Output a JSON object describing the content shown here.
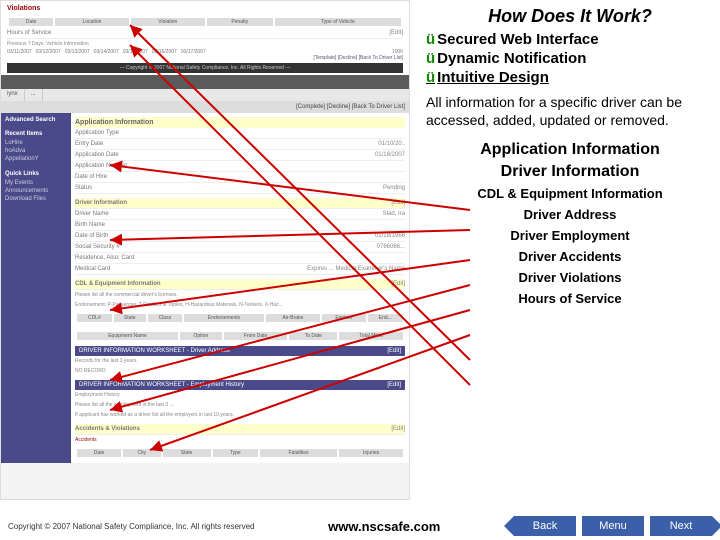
{
  "slide": {
    "heading": "How Does It Work?",
    "bullets": [
      "Secured Web Interface",
      "Dynamic Notification",
      "Intuitive Design"
    ],
    "paragraph": "All information for a specific driver can be accessed, added, updated or removed.",
    "info_titles": [
      "Application Information",
      "Driver Information"
    ],
    "info_items": [
      "CDL & Equipment Information",
      "Driver Address",
      "Driver Employment",
      "Driver Accidents",
      "Driver Violations",
      "Hours of Service"
    ],
    "url": "www.nscsafe.com",
    "copyright": "Copyright © 2007 National Safety Compliance, Inc. All rights reserved",
    "nav": {
      "back": "Back",
      "menu": "Menu",
      "next": "Next"
    }
  },
  "screenshot": {
    "top_section": {
      "violations_label": "Violations",
      "violations_cols": [
        "Date",
        "Location",
        "Violation",
        "Penalty",
        "Type of Vehicle"
      ],
      "hours_label": "Hours of Service",
      "hours_note": "Previous 7 Days, Vehicle Information",
      "dates": [
        "03/11/2007",
        "03/12/2007",
        "03/13/2007",
        "03/14/2007",
        "03/15/2007",
        "03/16/2007",
        "03/17/2007"
      ],
      "hours_total": "100h",
      "footer_links": "[Template]  [Decline]  [Back To Driver List]",
      "copyright_bar": "— Copyright © 2007 National Safety Compliance, Inc. All Rights Reserved —"
    },
    "toolbar_right": "[Complete]  [Decline]  [Back To Driver List]",
    "sidebar": {
      "adv_search": "Advanced Search",
      "recent_title": "Recent Items",
      "recent": [
        "LoHire",
        "hoAdva",
        "AppellationY"
      ],
      "quick_title": "Quick Links",
      "quick": [
        "My Events",
        "Announcements",
        "Download Files"
      ]
    },
    "app_info": {
      "title": "Application Information",
      "rows": [
        {
          "l": "Application Type",
          "r": ""
        },
        {
          "l": "Entry Date",
          "r": "01/10/20.."
        },
        {
          "l": "Application Date",
          "r": "01/18/2007"
        },
        {
          "l": "Application Number",
          "r": ""
        },
        {
          "l": "Date of Hire",
          "r": ""
        },
        {
          "l": "Status",
          "r": "Pending"
        }
      ]
    },
    "driver_info": {
      "title": "Driver Information",
      "edit": "[Edit]",
      "rows": [
        {
          "l": "Driver Name",
          "r": "Slad, Ira"
        },
        {
          "l": "Birth Name",
          "r": ""
        },
        {
          "l": "Date of Birth",
          "r": "01/18/1966"
        },
        {
          "l": "Social Security #",
          "r": "0786066..."
        },
        {
          "l": "Residence, Also: Card",
          "r": ""
        },
        {
          "l": "Medical Card",
          "r": "Expires ... Medical Examiner's Name"
        }
      ]
    },
    "cdl": {
      "title": "CDL & Equipment Information",
      "edit": "[Edit]",
      "note1": "Please list all the commercial driver's licenses.",
      "note2": "Endorsement: P-Passenger, T-Doubles & Triples, H-Hazardous Materials, N-Tankers, X-Haz...",
      "cols1": [
        "CDL#",
        "State",
        "Class",
        "Endorsements",
        "Air-Brake",
        "Expires",
        "End..."
      ],
      "cols2": [
        "Equipment Name",
        "Option",
        "From Date",
        "To Date",
        "Total Miles"
      ]
    },
    "worksheets": {
      "addr_title": "DRIVER INFORMATION WORKSHEET - Driver Address",
      "addr_note": "Records for the last 3 years.",
      "addr_rec": "NO RECORD",
      "emp_title": "DRIVER INFORMATION WORKSHEET - Employment History",
      "emp_note1": "Employment History",
      "emp_note2": "Please list all the employment in the last 3 ...",
      "emp_note3": "If applicant has worked as a driver list all the employers in last 10 years.",
      "acc_title": "Accidents & Violations",
      "acc_label": "Accidents",
      "acc_cols": [
        "Date",
        "City",
        "State",
        "Type",
        "Fatalities",
        "Injuries"
      ]
    }
  }
}
